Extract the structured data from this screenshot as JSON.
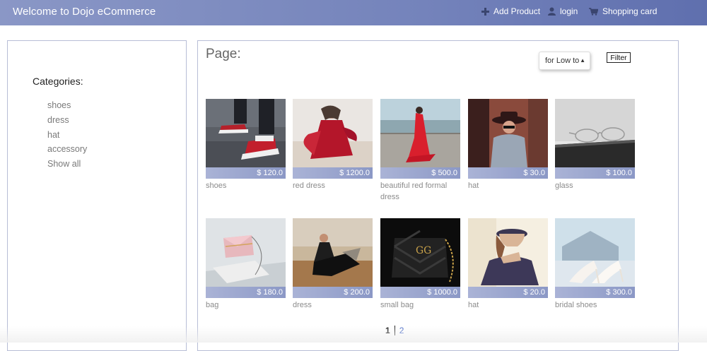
{
  "header": {
    "brand": "Welcome to Dojo eCommerce",
    "add_product": "Add Product",
    "login": "login",
    "cart": "Shopping card"
  },
  "sidebar": {
    "title": "Categories:",
    "items": [
      "shoes",
      "dress",
      "hat",
      "accessory",
      "Show all"
    ]
  },
  "main": {
    "page_title": "Page:",
    "sort_value": "for Low to",
    "filter_label": "Filter"
  },
  "products": [
    {
      "price": "$ 120.0",
      "name": "shoes"
    },
    {
      "price": "$ 1200.0",
      "name": "red dress"
    },
    {
      "price": "$ 500.0",
      "name": "beautiful red formal dress"
    },
    {
      "price": "$ 30.0",
      "name": "hat"
    },
    {
      "price": "$ 100.0",
      "name": "glass"
    },
    {
      "price": "$ 180.0",
      "name": "bag"
    },
    {
      "price": "$ 200.0",
      "name": "dress"
    },
    {
      "price": "$ 1000.0",
      "name": "small bag"
    },
    {
      "price": "$ 20.0",
      "name": "hat"
    },
    {
      "price": "$ 300.0",
      "name": "bridal shoes"
    }
  ],
  "pagination": {
    "current": "1",
    "next": "2"
  },
  "colors": {
    "header_start": "#8a97c6",
    "header_end": "#5f6fae",
    "price_bar": "#8b98c6",
    "link": "#4a6bc7"
  }
}
